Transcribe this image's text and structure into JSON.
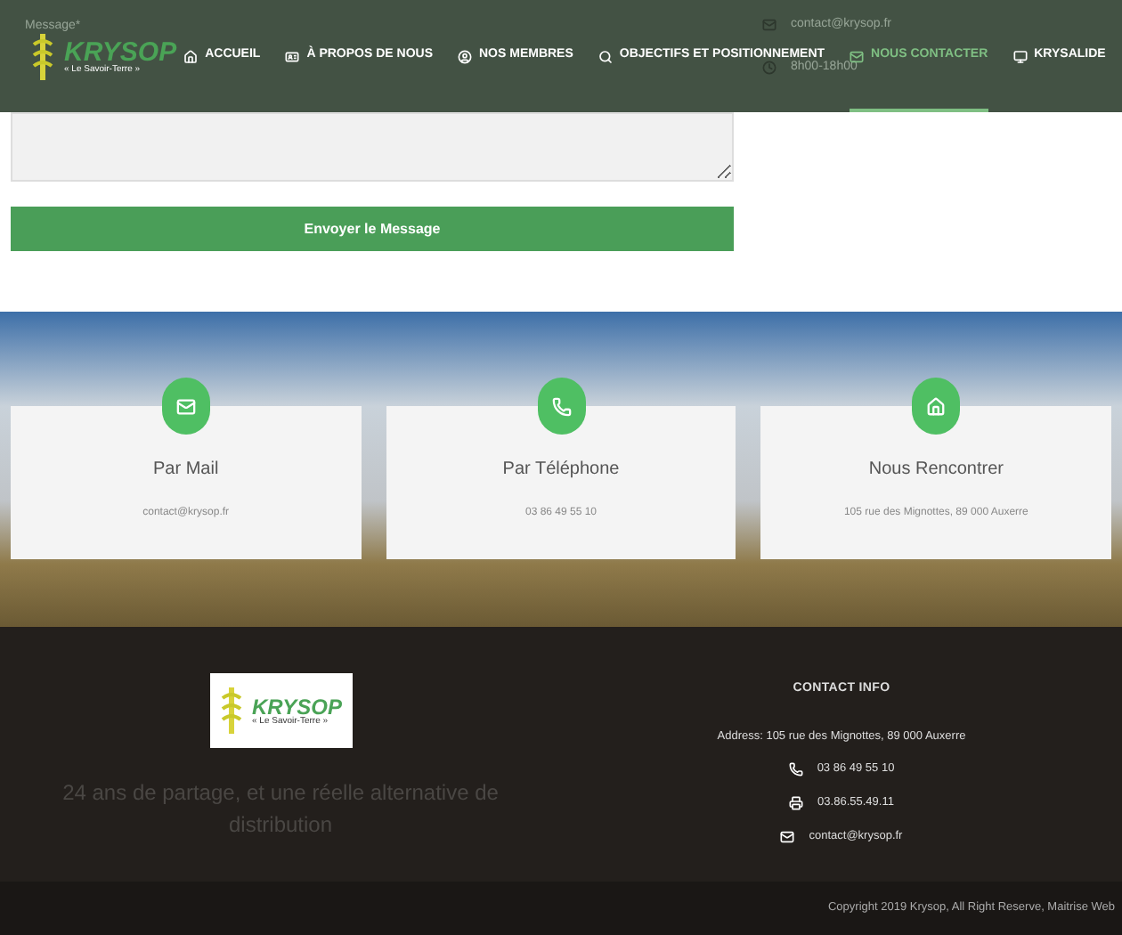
{
  "header": {
    "logo": {
      "name": "KRYSOP",
      "tagline": "« Le Savoir-Terre »"
    },
    "background_texts": [
      {
        "kind": "label",
        "text": "Message*"
      },
      {
        "kind": "mail",
        "text": "contact@krysop.fr"
      },
      {
        "kind": "clock",
        "text": "8h00-18h00"
      }
    ],
    "nav": [
      {
        "label": "ACCUEIL",
        "selected": false
      },
      {
        "label": "À PROPOS DE NOUS",
        "selected": false
      },
      {
        "label": "NOS MEMBRES",
        "selected": false
      },
      {
        "label": "OBJECTIFS ET POSITIONNEMENT",
        "selected": false
      },
      {
        "label": "NOUS CONTACTER",
        "selected": true
      },
      {
        "label": "KRYSALIDE",
        "selected": false
      }
    ]
  },
  "form": {
    "submit": "Envoyer le Message"
  },
  "contact_cards": [
    {
      "title": "Par Mail",
      "text": "contact@krysop.fr"
    },
    {
      "title": "Par Téléphone",
      "text": "03 86 49 55 10"
    },
    {
      "title": "Nous Rencontrer",
      "text": "105 rue des Mignottes, 89 000 Auxerre"
    }
  ],
  "footer": {
    "logo": {
      "name": "KRYSOP",
      "tagline": "« Le Savoir-Terre »"
    },
    "slogan": "24 ans de partage, et une réelle alternative de distribution",
    "contact_info": {
      "title": "CONTACT INFO",
      "address": "Address: 105 rue des Mignottes, 89 000 Auxerre",
      "lines": [
        {
          "text": "03 86 49 55 10"
        },
        {
          "text": "03.86.55.49.11"
        },
        {
          "text": "contact@krysop.fr"
        }
      ]
    }
  },
  "copyright": "Copyright 2019 Krysop, All Right Reserve, Maitrise Web"
}
